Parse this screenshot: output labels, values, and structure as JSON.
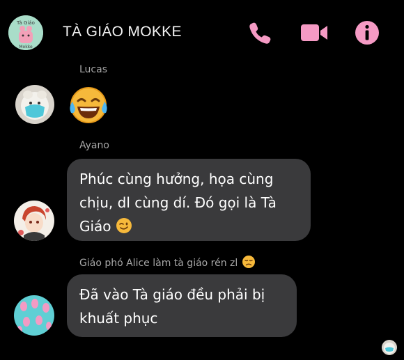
{
  "header": {
    "title": "TÀ GIÁO MOKKE",
    "avatar_text": "Tà Giáo Mokke",
    "icons": [
      "phone-icon",
      "video-camera-icon",
      "info-icon"
    ],
    "accent_color": "#f59ac4"
  },
  "messages": [
    {
      "sender": "Lucas",
      "content": "face-with-tears-of-joy-emoji"
    },
    {
      "sender": "Ayano",
      "text": "Phúc cùng hưởng, họa cùng chịu, dl cùng dí. Đó gọi là Tà Giáo",
      "emoji": "winking-face-emoji"
    },
    {
      "nickname_notice": "Giáo phó Alice làm tà giáo rén zl",
      "emoji": "disappointed-face-emoji",
      "text": "Đã vào Tà giáo đều phải bị khuất phục"
    }
  ],
  "colors": {
    "background": "#000000",
    "bubble": "#3a3a3c",
    "sender_name": "#a7a7a7"
  }
}
